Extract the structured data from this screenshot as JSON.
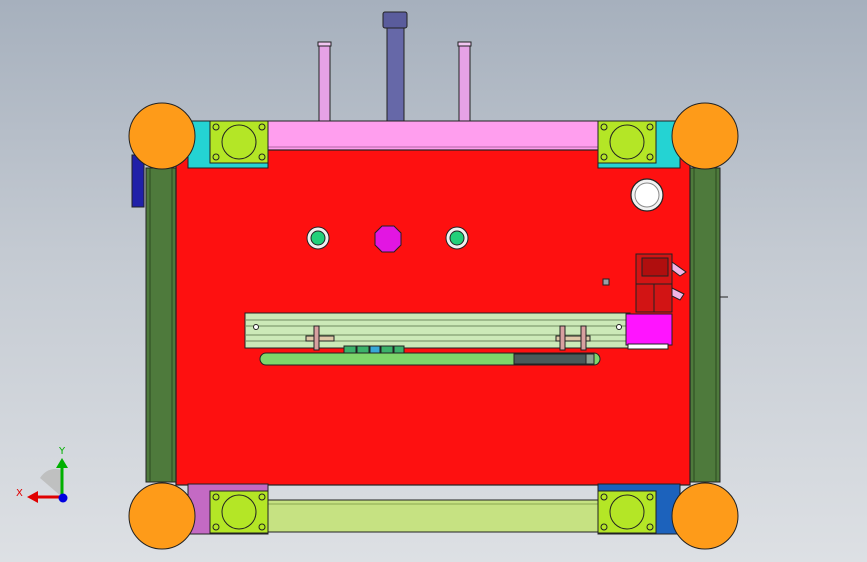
{
  "viewport": {
    "background_top": "#a6b0bd",
    "background_bottom": "#dde0e4"
  },
  "model": {
    "base_plate_color": "#fe1010",
    "side_rail_color": "#4e7a3c",
    "corner_wheel_color": "#fe9b19",
    "bracket_cyan_color": "#24d3d3",
    "bracket_purple_color": "#c46ac4",
    "bracket_blue_color": "#1c62bc",
    "bearing_block_color": "#b4e626",
    "top_bar_color": "#ff9eee",
    "bottom_bar_color": "#c6e282",
    "slide_rail_color": "#cce9b8",
    "motor_color": "#d21414",
    "magenta_block_color": "#ff14ff",
    "green_bar_color": "#7ed66b"
  },
  "triad": {
    "x_label": "X",
    "y_label": "Y",
    "x_color": "#e00000",
    "y_color": "#00b000",
    "z_color": "#0000e0"
  }
}
